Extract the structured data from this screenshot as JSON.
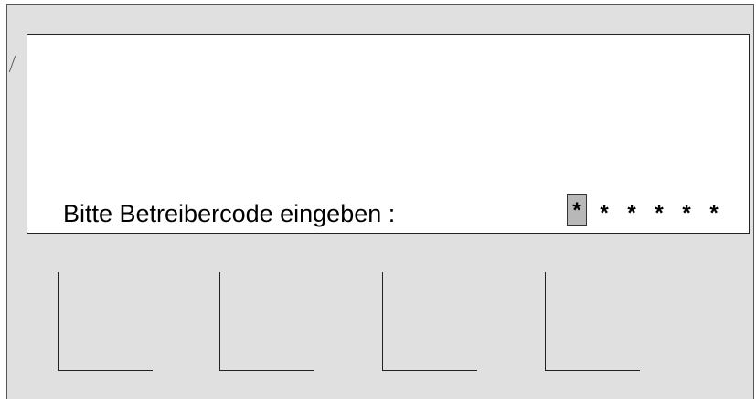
{
  "display": {
    "prompt": "Bitte Betreibercode eingeben :",
    "pin_mask": [
      "*",
      "*",
      "*",
      "*",
      "*",
      "*"
    ],
    "active_index": 0
  },
  "softkeys": [
    {
      "label": ""
    },
    {
      "label": ""
    },
    {
      "label": ""
    },
    {
      "label": ""
    }
  ]
}
